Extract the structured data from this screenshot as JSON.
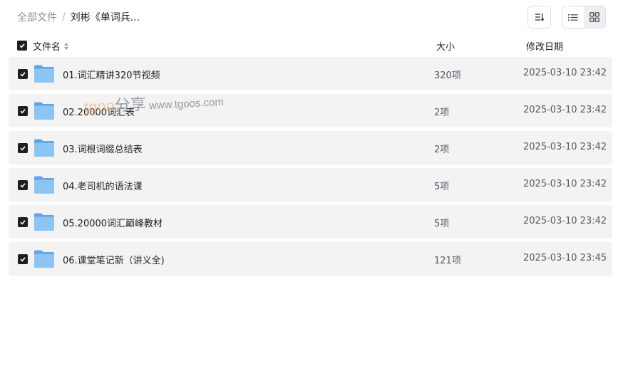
{
  "breadcrumb": {
    "root": "全部文件",
    "separator": "/",
    "current": "刘彬《单词兵..."
  },
  "toolbar": {
    "sort_icon": "sort-icon",
    "list_view_icon": "list-view-icon",
    "grid_view_icon": "grid-view-icon",
    "active_view": "grid"
  },
  "table": {
    "headers": {
      "name": "文件名",
      "size": "大小",
      "date": "修改日期"
    },
    "rows": [
      {
        "name": "01.词汇精讲320节视频",
        "size": "320项",
        "date": "2025-03-10 23:42"
      },
      {
        "name": "02.20000词汇表",
        "size": "2项",
        "date": "2025-03-10 23:42"
      },
      {
        "name": "03.词根词缀总结表",
        "size": "2项",
        "date": "2025-03-10 23:42"
      },
      {
        "name": "04.老司机的语法课",
        "size": "5项",
        "date": "2025-03-10 23:42"
      },
      {
        "name": "05.20000词汇巅峰教材",
        "size": "5项",
        "date": "2025-03-10 23:42"
      },
      {
        "name": "06.课堂笔记新（讲义全)",
        "size": "121项",
        "date": "2025-03-10 23:45"
      }
    ]
  },
  "watermark": {
    "logo": "tgoo",
    "fenxiang": "分享",
    "url": "www.tgoos.com"
  },
  "colors": {
    "checkbox": "#1f1f1f",
    "row_bg": "#f3f3f4",
    "folder": "#7db8ef",
    "muted_text": "#8a8f99"
  }
}
